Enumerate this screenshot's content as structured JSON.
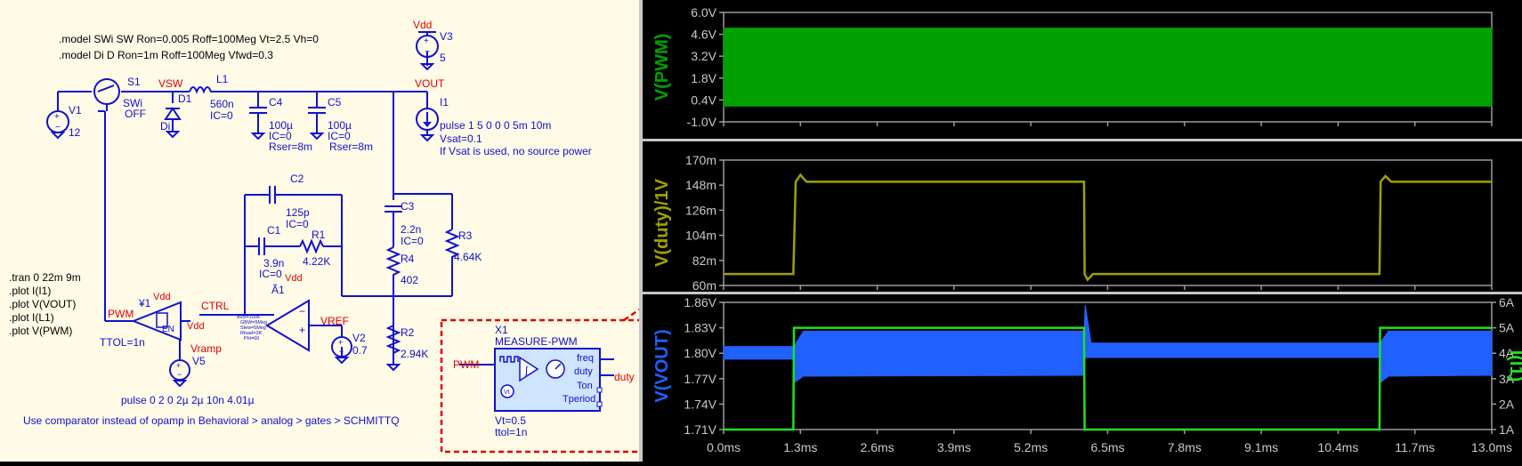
{
  "schematic": {
    "directives": {
      "model_sw": ".model SWi SW Ron=0.005 Roff=100Meg Vt=2.5 Vh=0",
      "model_d": ".model Di D Ron=1m Roff=100Meg Vfwd=0.3",
      "tran": ".tran 0 22m 9m",
      "plot1": ".plot I(I1)",
      "plot2": ".plot V(VOUT)",
      "plot3": ".plot I(L1)",
      "plot4": ".plot V(PWM)",
      "hint": "Use comparator instead of opamp in Behavioral > analog > gates > SCHMITTQ"
    },
    "nets": {
      "vsw": "VSW",
      "vout": "VOUT",
      "ctrl": "CTRL",
      "pwm": "PWM",
      "vramp": "Vramp",
      "vref": "VREF",
      "vdd": "Vdd",
      "duty": "duty"
    },
    "components": {
      "v1": {
        "name": "V1",
        "value": "12"
      },
      "s1": {
        "name": "S1",
        "model": "SWi",
        "state": "OFF"
      },
      "d1": {
        "name": "D1",
        "model": "Di"
      },
      "l1": {
        "name": "L1",
        "value": "560n",
        "ic": "IC=0"
      },
      "c4": {
        "name": "C4",
        "value": "100µ",
        "ic": "IC=0",
        "rser": "Rser=8m"
      },
      "c5": {
        "name": "C5",
        "value": "100µ",
        "ic": "IC=0",
        "rser": "Rser=8m"
      },
      "i1": {
        "name": "I1",
        "value": "pulse 1 5 0 0 0 5m 10m",
        "vsat": "Vsat=0.1",
        "note": "If Vsat is used, no source power"
      },
      "v3": {
        "name": "V3",
        "value": "5"
      },
      "c2": {
        "name": "C2",
        "value": "125p",
        "ic": "IC=0"
      },
      "c1": {
        "name": "C1",
        "value": "3.9n",
        "ic": "IC=0"
      },
      "r1": {
        "name": "R1",
        "value": "4.22K"
      },
      "c3": {
        "name": "C3",
        "value": "2.2n",
        "ic": "IC=0"
      },
      "r3": {
        "name": "R3",
        "value": "4.64K"
      },
      "r4": {
        "name": "R4",
        "value": "402"
      },
      "r2": {
        "name": "R2",
        "value": "2.94K"
      },
      "v2": {
        "name": "V2",
        "value": "0.7"
      },
      "a1": {
        "name": "Ã1",
        "params": [
          "Avol=100K",
          "GBW=5Meg",
          "Slew=5Meg",
          "Rload=2K",
          "Phi=60"
        ]
      },
      "y1": {
        "name": "¥1",
        "en": "EN",
        "ttol": "TTOL=1n"
      },
      "v5": {
        "name": "V5",
        "value": "pulse 0 2 0 2µ 2µ 10n 4.01µ"
      },
      "x1": {
        "name": "X1",
        "model": "MEASURE-PWM",
        "pins": [
          "freq",
          "duty",
          "Ton",
          "Tperiod"
        ],
        "vt": "Vt=0.5",
        "ttol": "ttol=1n"
      }
    }
  },
  "plots": {
    "pane1": {
      "label": "V(PWM)",
      "color": "#00a000",
      "yticks": [
        "6.0V",
        "4.6V",
        "3.2V",
        "1.8V",
        "0.4V",
        "-1.0V"
      ]
    },
    "pane2": {
      "label": "V(duty)/1V",
      "color": "#a0a000",
      "yticks": [
        "170m",
        "148m",
        "126m",
        "104m",
        "82m",
        "60m"
      ]
    },
    "pane3": {
      "label_left": "V(VOUT)",
      "label_right": "I(I1)",
      "color_left": "#2060ff",
      "color_right": "#20e020",
      "yticks_left": [
        "1.86V",
        "1.83V",
        "1.80V",
        "1.77V",
        "1.74V",
        "1.71V"
      ],
      "yticks_right": [
        "6A",
        "5A",
        "4A",
        "3A",
        "2A",
        "1A"
      ]
    },
    "xticks": [
      "0.0ms",
      "1.3ms",
      "2.6ms",
      "3.9ms",
      "5.2ms",
      "6.5ms",
      "7.8ms",
      "9.1ms",
      "10.4ms",
      "11.7ms",
      "13.0ms"
    ]
  },
  "chart_data": [
    {
      "type": "line",
      "title": "",
      "xlabel": "",
      "ylabel": "V(PWM)",
      "xlim": [
        0,
        13
      ],
      "ylim": [
        -1.0,
        6.0
      ],
      "series": [
        {
          "name": "V(PWM)",
          "x": [
            0,
            13
          ],
          "y_min": [
            0.0,
            0.0
          ],
          "y_max": [
            5.0,
            5.0
          ]
        }
      ]
    },
    {
      "type": "line",
      "title": "",
      "xlabel": "",
      "ylabel": "V(duty)/1V",
      "xlim": [
        0,
        13
      ],
      "ylim": [
        0.06,
        0.17
      ],
      "series": [
        {
          "name": "V(duty)/1V",
          "x": [
            0,
            1.18,
            1.22,
            1.3,
            1.4,
            6.1,
            6.11,
            6.16,
            6.25,
            11.1,
            11.12,
            11.2,
            11.3,
            13.0
          ],
          "y": [
            0.07,
            0.07,
            0.151,
            0.157,
            0.151,
            0.151,
            0.07,
            0.065,
            0.07,
            0.07,
            0.151,
            0.156,
            0.151,
            0.151
          ]
        }
      ]
    },
    {
      "type": "line",
      "title": "",
      "xlabel": "",
      "ylabel": "V(VOUT)",
      "xlim": [
        0,
        13
      ],
      "ylim": [
        1.71,
        1.86
      ],
      "series": [
        {
          "name": "V(VOUT)",
          "x": [
            0,
            1.18,
            1.19,
            1.35,
            6.1,
            6.12,
            6.22,
            11.1,
            11.11,
            11.25,
            13.0
          ],
          "y_min": [
            1.793,
            1.793,
            1.765,
            1.773,
            1.774,
            1.795,
            1.795,
            1.795,
            1.765,
            1.773,
            1.774
          ],
          "y_max": [
            1.808,
            1.808,
            1.808,
            1.826,
            1.826,
            1.857,
            1.812,
            1.812,
            1.812,
            1.826,
            1.826
          ]
        },
        {
          "name": "I(I1)",
          "axis": "right",
          "ylim": [
            1,
            6
          ],
          "x": [
            0,
            1.18,
            1.19,
            6.1,
            6.11,
            11.1,
            11.11,
            13.0
          ],
          "y": [
            1,
            1,
            5,
            5,
            1,
            1,
            5,
            5
          ]
        }
      ]
    }
  ]
}
